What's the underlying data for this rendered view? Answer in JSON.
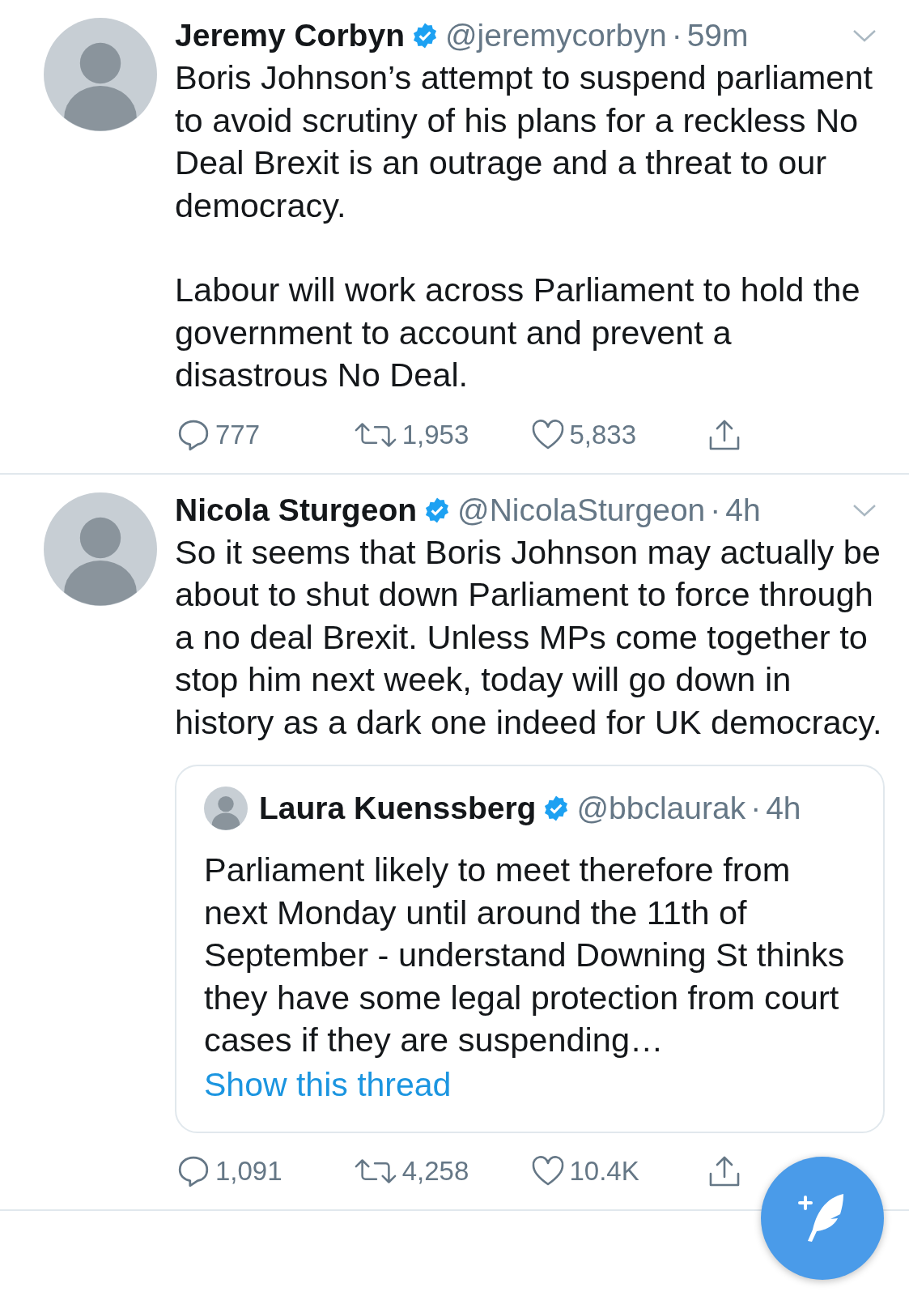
{
  "tweets": [
    {
      "name": "Jeremy Corbyn",
      "verified": true,
      "handle": "@jeremycorbyn",
      "separator": "·",
      "time": "59m",
      "paragraphs": [
        "Boris Johnson’s attempt to suspend parliament to avoid scrutiny of his plans for a reckless No Deal Brexit is an outrage and a threat to our democracy.",
        "Labour will work across Parliament to hold the government to account and prevent a disastrous No Deal."
      ],
      "actions": [
        {
          "kind": "reply",
          "count": "777"
        },
        {
          "kind": "retweet",
          "count": "1,953"
        },
        {
          "kind": "like",
          "count": "5,833"
        },
        {
          "kind": "share"
        }
      ]
    },
    {
      "name": "Nicola Sturgeon",
      "verified": true,
      "handle": "@NicolaSturgeon",
      "separator": "·",
      "time": "4h",
      "paragraphs": [
        "So it seems that Boris Johnson may actually be about to shut down Parliament to force through a no deal Brexit. Unless MPs come together to stop him next week, today will go down in history as a dark one indeed for UK democracy."
      ],
      "quote": {
        "name": "Laura Kuenssberg",
        "verified": true,
        "handle": "@bbclaurak",
        "separator": "·",
        "time": "4h",
        "text": "Parliament likely to meet therefore from next Monday until around the 11th of September - understand Downing St thinks they have some legal protection from court cases if they are suspending…",
        "link": "Show this thread"
      },
      "actions": [
        {
          "kind": "reply",
          "count": "1,091"
        },
        {
          "kind": "retweet",
          "count": "4,258"
        },
        {
          "kind": "like",
          "count": "10.4K"
        },
        {
          "kind": "share"
        }
      ]
    }
  ]
}
